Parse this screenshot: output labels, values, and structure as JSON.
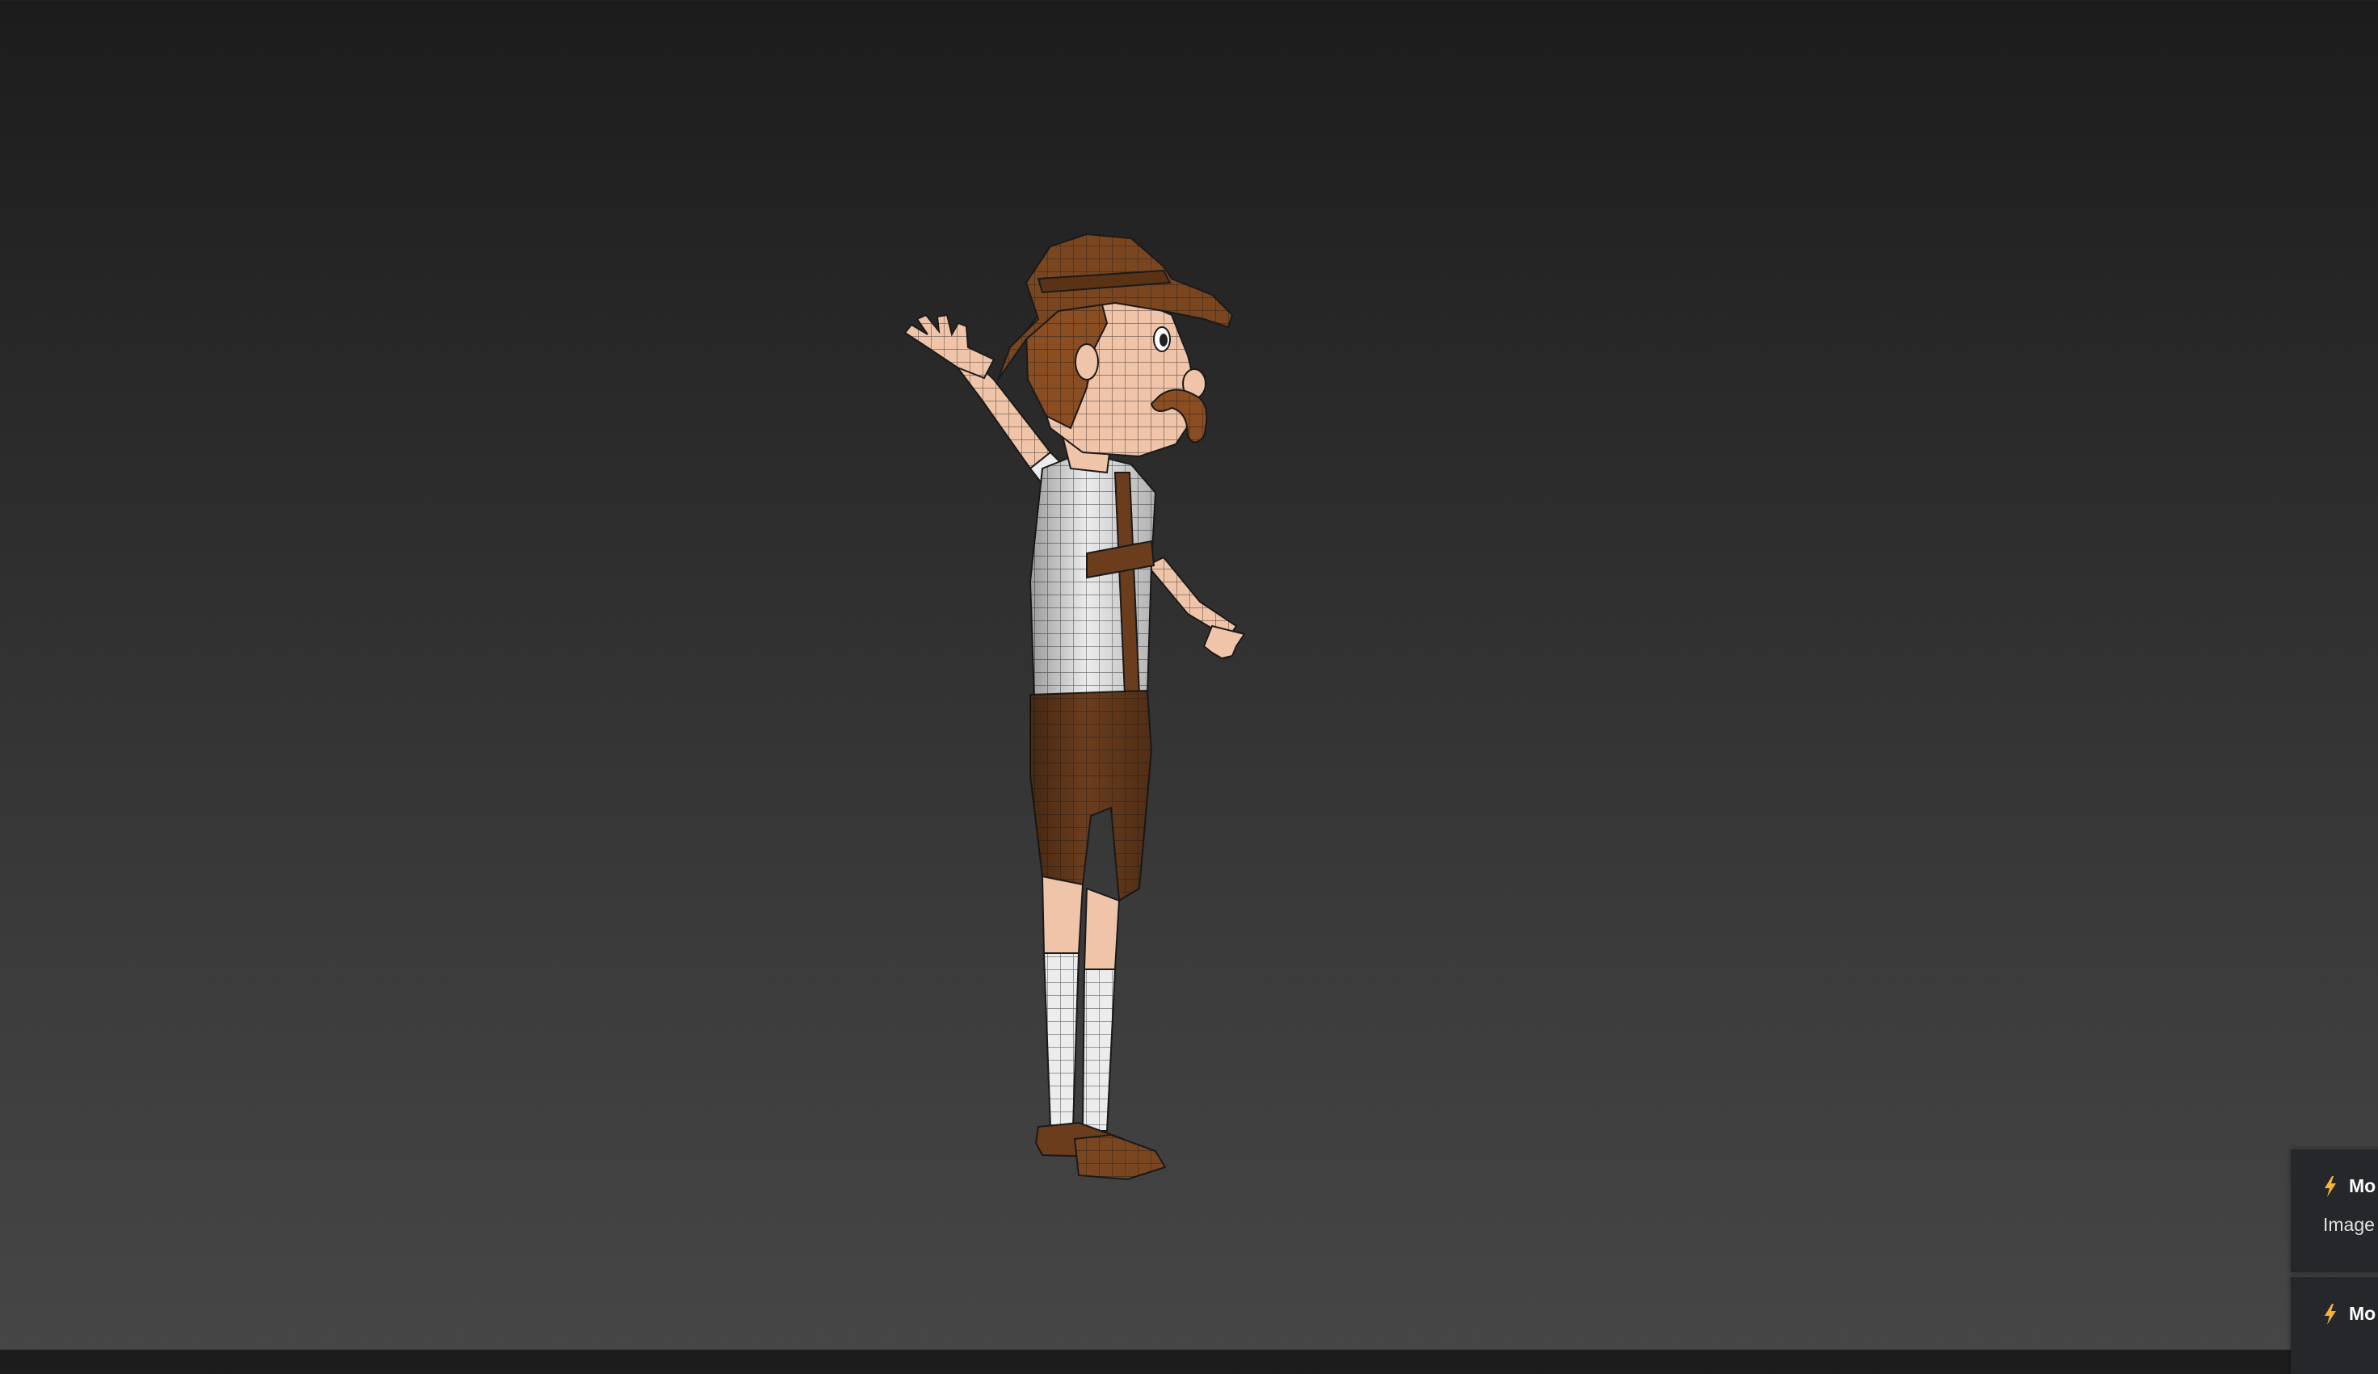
{
  "viewport": {
    "background_top": "#1c1c1c",
    "background_bottom": "#464646",
    "subject": "wireframe-character-model",
    "colors": {
      "hat": "#7a4620",
      "leather": "#6b3d1d",
      "shirt": "#ececec",
      "skin": "#f0c4a8",
      "hair": "#8a4e22",
      "wire": "#1a1a1a"
    }
  },
  "notifications": [
    {
      "icon": "lightning-bolt-icon",
      "title": "Mo",
      "body": "Image c"
    },
    {
      "icon": "lightning-bolt-icon",
      "title": "Mo",
      "body": ""
    }
  ]
}
